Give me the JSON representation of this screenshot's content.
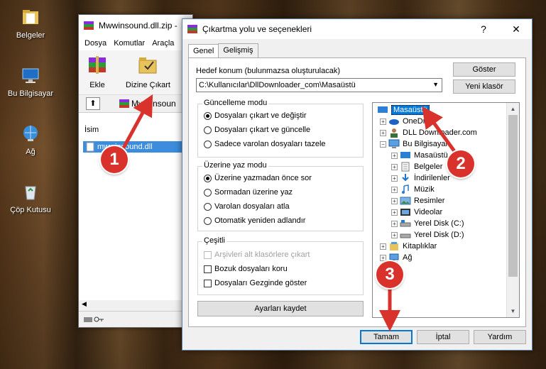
{
  "desktop": {
    "icons": [
      {
        "label": "Belgeler"
      },
      {
        "label": "Bu Bilgisayar"
      },
      {
        "label": "Ağ"
      },
      {
        "label": "Çöp Kutusu"
      }
    ]
  },
  "winrar": {
    "title": "Mwwinsound.dll.zip -",
    "menu": [
      "Dosya",
      "Komutlar",
      "Araçla"
    ],
    "toolbar": {
      "add_label": "Ekle",
      "extract_label": "Dizine Çıkart"
    },
    "path": "Mwwinsoun",
    "list_header": "İsim",
    "file_name": "mwwinsound.dll"
  },
  "dialog": {
    "title": "Çıkartma yolu ve seçenekleri",
    "close_glyph": "✕",
    "help_glyph": "?",
    "tabs": [
      "Genel",
      "Gelişmiş"
    ],
    "dest_label": "Hedef konum (bulunmazsa oluşturulacak)",
    "dest_value": "C:\\Kullanıcılar\\DllDownloader_com\\Masaüstü",
    "show_button": "Göster",
    "new_folder_button": "Yeni klasör",
    "update_mode": {
      "title": "Güncelleme modu",
      "options": [
        "Dosyaları çıkart ve değiştir",
        "Dosyaları çıkart ve güncelle",
        "Sadece varolan dosyaları tazele"
      ],
      "selected": 0
    },
    "overwrite_mode": {
      "title": "Üzerine yaz modu",
      "options": [
        "Üzerine yazmadan önce sor",
        "Sormadan üzerine yaz",
        "Varolan dosyaları atla",
        "Otomatik yeniden adlandır"
      ],
      "selected": 0
    },
    "misc": {
      "title": "Çeşitli",
      "options": [
        "Arşivleri alt klasörlere çıkart",
        "Bozuk dosyaları koru",
        "Dosyaları Gezginde göster"
      ]
    },
    "save_settings_button": "Ayarları kaydet",
    "tree": [
      {
        "label": "Masaüstü",
        "selected": true
      },
      {
        "label": "OneDrive"
      },
      {
        "label": "DLL Downloader.com"
      },
      {
        "label": "Bu Bilgisayar"
      },
      {
        "label": "Masaüstü"
      },
      {
        "label": "Belgeler"
      },
      {
        "label": "İndirilenler"
      },
      {
        "label": "Müzik"
      },
      {
        "label": "Resimler"
      },
      {
        "label": "Videolar"
      },
      {
        "label": "Yerel Disk (C:)"
      },
      {
        "label": "Yerel Disk (D:)"
      },
      {
        "label": "Kitaplıklar"
      },
      {
        "label": "Ağ"
      }
    ],
    "ok_button": "Tamam",
    "cancel_button": "İptal",
    "help_button": "Yardım"
  },
  "callouts": [
    "1",
    "2",
    "3"
  ],
  "colors": {
    "callout": "#d9322c",
    "selection": "#0078d7"
  }
}
